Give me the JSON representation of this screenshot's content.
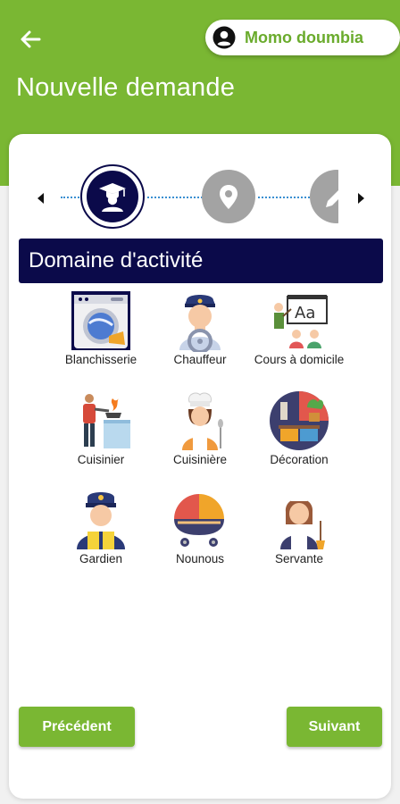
{
  "header": {
    "title": "Nouvelle demande",
    "user_name": "Momo doumbia"
  },
  "stepper": {
    "steps": [
      {
        "icon": "graduate-icon",
        "state": "active"
      },
      {
        "icon": "location-pin-icon",
        "state": "inactive"
      },
      {
        "icon": "pencil-icon",
        "state": "inactive"
      }
    ]
  },
  "section": {
    "title": "Domaine d'activité"
  },
  "categories": [
    {
      "label": "Blanchisserie",
      "icon": "washing-machine-icon"
    },
    {
      "label": "Chauffeur",
      "icon": "driver-icon"
    },
    {
      "label": "Cours à domicile",
      "icon": "teacher-icon"
    },
    {
      "label": "Cuisinier",
      "icon": "cook-icon"
    },
    {
      "label": "Cuisinière",
      "icon": "female-cook-icon"
    },
    {
      "label": "Décoration",
      "icon": "decoration-icon"
    },
    {
      "label": "Gardien",
      "icon": "guard-icon"
    },
    {
      "label": "Nounous",
      "icon": "baby-stroller-icon"
    },
    {
      "label": "Servante",
      "icon": "maid-icon"
    }
  ],
  "footer": {
    "prev_label": "Précédent",
    "next_label": "Suivant"
  },
  "colors": {
    "brand_green": "#7ab733",
    "navy": "#0b0a4a",
    "step_inactive": "#a3a3a3"
  }
}
